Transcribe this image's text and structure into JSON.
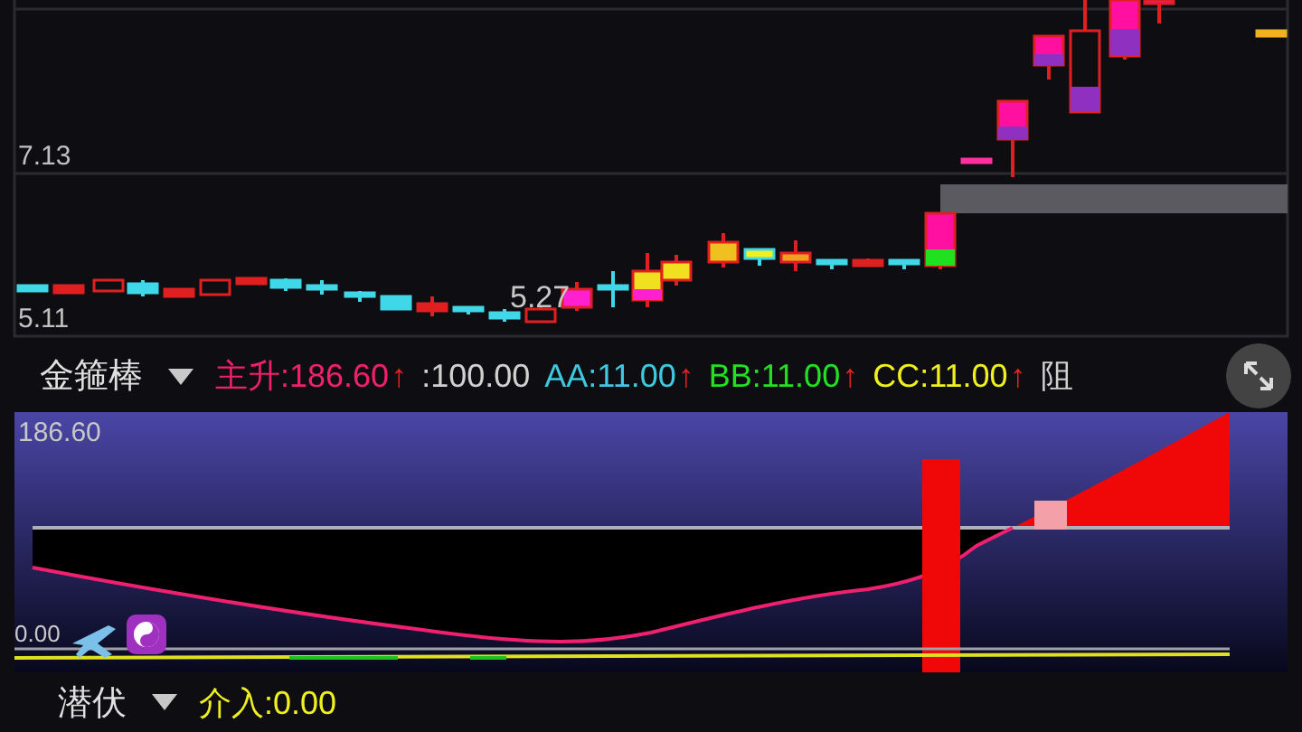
{
  "price_chart": {
    "axis_labels": [
      "7.13",
      "5.11"
    ],
    "low_marker": "5.27"
  },
  "indicator_bar": {
    "name": "金箍棒",
    "values": [
      {
        "text": "主升:186.60",
        "arrow": "↑",
        "color": "#f0206a"
      },
      {
        "text": ":100.00",
        "color": "#d0d0d0"
      },
      {
        "text": "AA:11.00",
        "arrow": "↑",
        "color": "#3fc8e0"
      },
      {
        "text": "BB:11.00",
        "arrow": "↑",
        "color": "#22e022"
      },
      {
        "text": "CC:11.00",
        "arrow": "↑",
        "color": "#f0f020"
      },
      {
        "text": "阻",
        "color": "#d0d0d0"
      }
    ]
  },
  "indicator_chart": {
    "max_label": "186.60",
    "min_label": "0.00"
  },
  "bottom_bar": {
    "name": "潜伏",
    "values": [
      {
        "text": "介入:0.00",
        "color": "#f0f020"
      }
    ]
  }
}
